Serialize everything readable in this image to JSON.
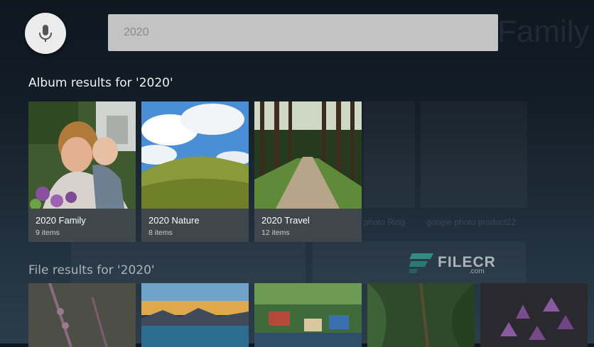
{
  "search": {
    "query": "2020"
  },
  "background": {
    "ghost_title": "Family",
    "ghost_caption_1": "photo Ring",
    "ghost_caption_2": "google photo product22"
  },
  "albums": {
    "heading": "Album results for '2020'",
    "items": [
      {
        "title": "2020 Family",
        "count": "9 items"
      },
      {
        "title": "2020 Nature",
        "count": "8 items"
      },
      {
        "title": "2020 Travel",
        "count": "12 items"
      }
    ]
  },
  "files": {
    "heading": "File results for '2020'"
  },
  "watermark": {
    "brand": "FILECR",
    "suffix": ".com"
  },
  "icons": {
    "mic": "microphone-icon"
  }
}
